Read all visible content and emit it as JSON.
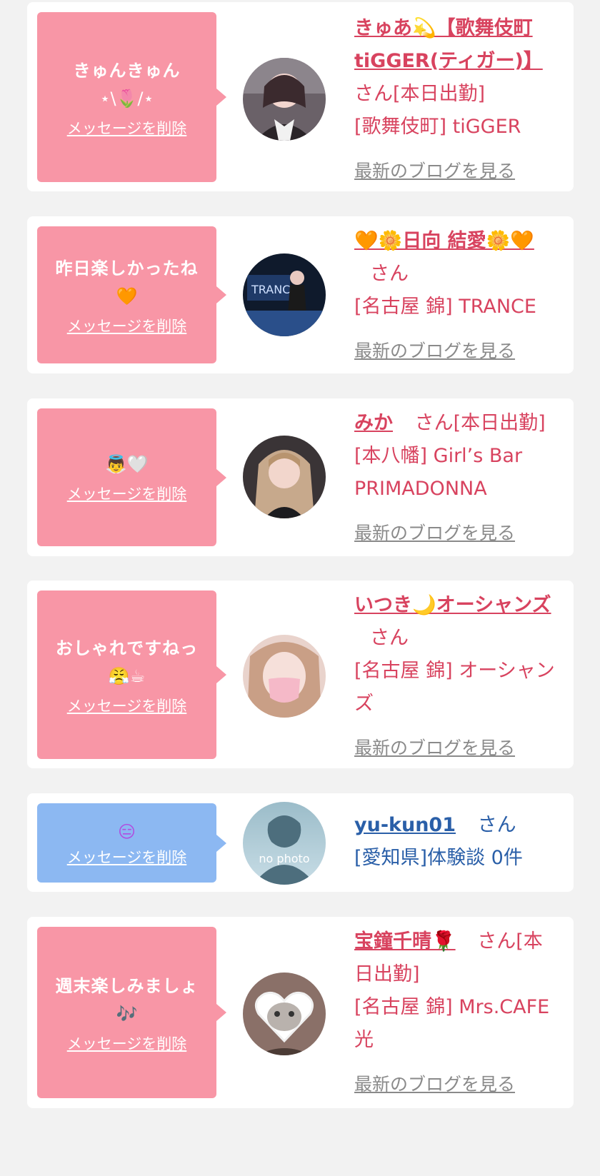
{
  "cards": [
    {
      "message": "きゅんきゅん",
      "message_emoji": "⋆\\🌷/⋆",
      "delete_label": "メッセージを削除",
      "name": "きゅあ💫【歌舞伎町tiGGER(ティガー)】",
      "suffix": "さん[本日出勤]",
      "shop": "[歌舞伎町] tiGGER",
      "blog_label": "最新のブログを見る"
    },
    {
      "message": "昨日楽しかったね",
      "message_emoji": "🧡",
      "delete_label": "メッセージを削除",
      "name": "🧡🌼日向 結愛🌼🧡",
      "suffix": "さん",
      "shop": "[名古屋 錦] TRANCE",
      "blog_label": "最新のブログを見る"
    },
    {
      "message": "",
      "message_emoji": "👼🤍",
      "delete_label": "メッセージを削除",
      "name": "みか",
      "suffix": "さん[本日出勤]",
      "shop": "[本八幡] Girl’s Bar PRIMADONNA",
      "blog_label": "最新のブログを見る"
    },
    {
      "message": "おしゃれですねっ",
      "message_emoji": "😤☕",
      "delete_label": "メッセージを削除",
      "name": "いつき🌙オーシャンズ",
      "suffix": "さん",
      "shop": "[名古屋 錦] オーシャンズ",
      "blog_label": "最新のブログを見る"
    },
    {
      "message": "",
      "message_emoji": "😑",
      "delete_label": "メッセージを削除",
      "name": "yu-kun01",
      "suffix": "さん",
      "shop": "[愛知県]体験談 0件",
      "avatar_text": "no photo"
    },
    {
      "message": "週末楽しみましょ",
      "message_emoji": "🎶",
      "delete_label": "メッセージを削除",
      "name": "宝鐘千晴🌹",
      "suffix": "さん[本日出勤]",
      "shop": "[名古屋 錦] Mrs.CAFE 光",
      "blog_label": "最新のブログを見る"
    }
  ],
  "colors": {
    "pink_bubble": "#f896a6",
    "blue_bubble": "#8cb8f2",
    "cast_text": "#d8435f",
    "user_text": "#2a5fa8",
    "link_gray": "#8a8a8a",
    "page_bg": "#f2f2f2"
  }
}
